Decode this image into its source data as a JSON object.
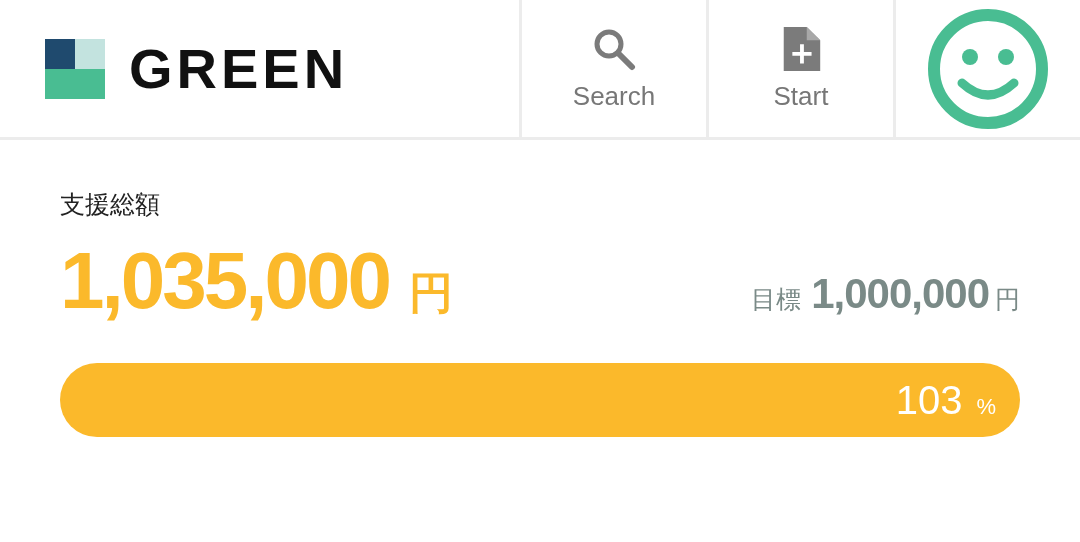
{
  "header": {
    "logo_text": "GREEN",
    "nav": [
      {
        "label": "Search",
        "kind": "search"
      },
      {
        "label": "Start",
        "kind": "start"
      }
    ]
  },
  "funding": {
    "total_label": "支援総額",
    "total_amount": "1,035,000",
    "total_unit": "円",
    "goal_label": "目標",
    "goal_amount": "1,000,000",
    "goal_unit": "円",
    "progress": {
      "percent": "103",
      "percent_unit": "%"
    }
  }
}
